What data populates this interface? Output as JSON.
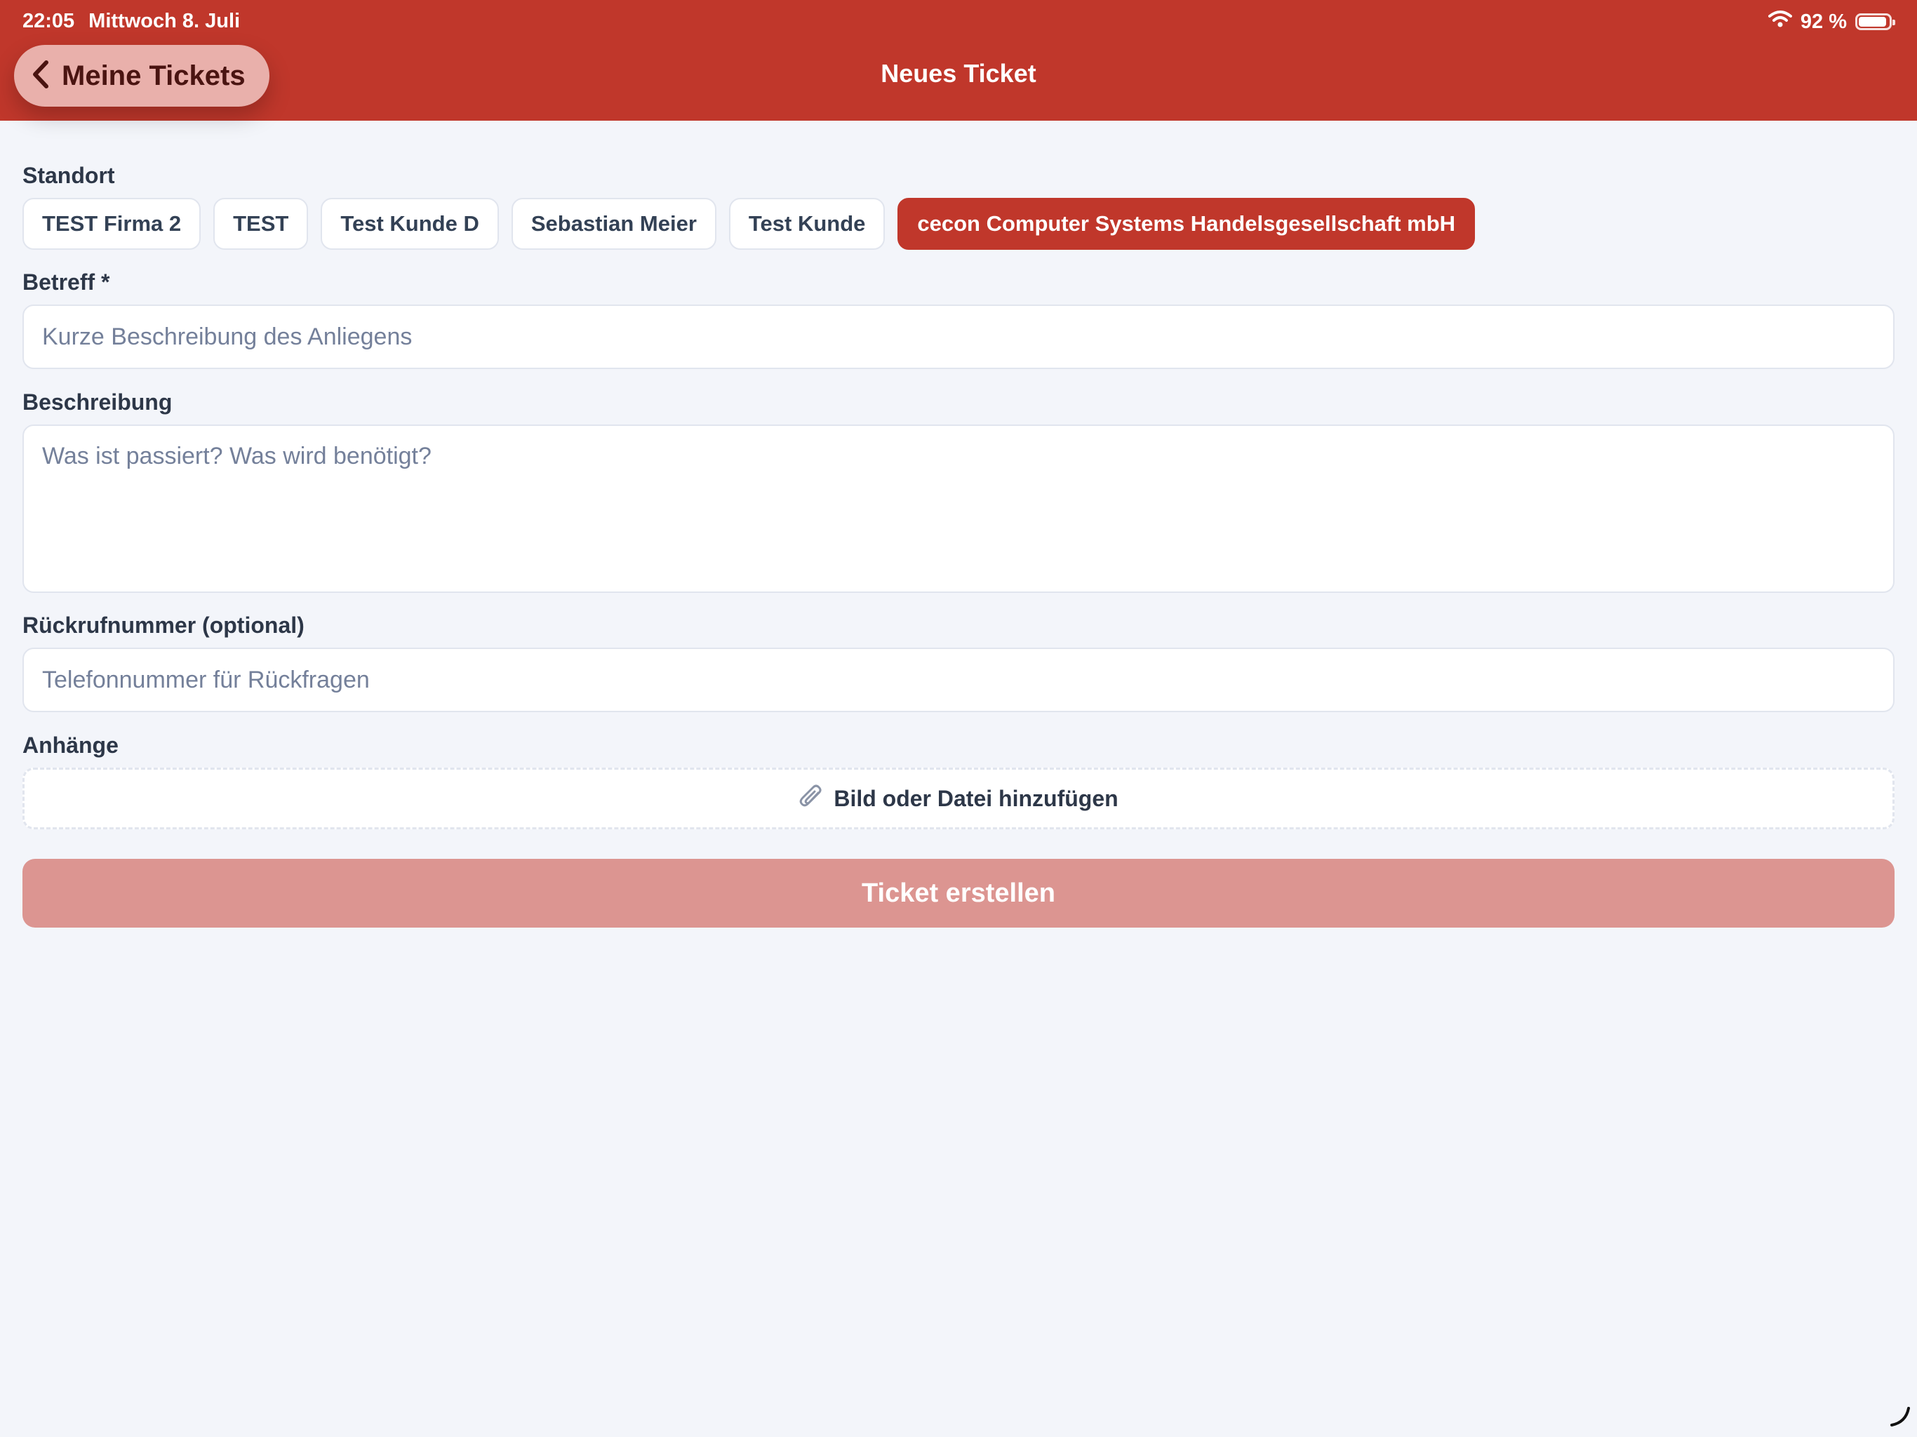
{
  "status_bar": {
    "time": "22:05",
    "date": "Mittwoch 8. Juli",
    "battery": "92 %",
    "battery_level": 0.92
  },
  "header": {
    "back_label": "Meine Tickets",
    "title": "Neues Ticket"
  },
  "form": {
    "location": {
      "label": "Standort",
      "options": [
        "TEST Firma 2",
        "TEST",
        "Test Kunde D",
        "Sebastian Meier",
        "Test Kunde",
        "cecon Computer Systems Handelsgesellschaft mbH"
      ],
      "selected": "cecon Computer Systems Handelsgesellschaft mbH"
    },
    "subject": {
      "label": "Betreff *",
      "value": "",
      "placeholder": "Kurze Beschreibung des Anliegens"
    },
    "description": {
      "label": "Beschreibung",
      "value": "",
      "placeholder": "Was ist passiert? Was wird benötigt?"
    },
    "callback": {
      "label": "Rückrufnummer (optional)",
      "value": "",
      "placeholder": "Telefonnummer für Rückfragen"
    },
    "attachments": {
      "label": "Anhänge",
      "button_label": "Bild oder Datei hinzufügen"
    },
    "submit_label": "Ticket erstellen"
  },
  "colors": {
    "brand_red": "#c0372b",
    "submit_disabled": "#dc9591",
    "background": "#f3f5fa"
  },
  "icons": [
    "wifi-icon",
    "battery-icon",
    "chevron-left-icon",
    "paperclip-icon"
  ]
}
